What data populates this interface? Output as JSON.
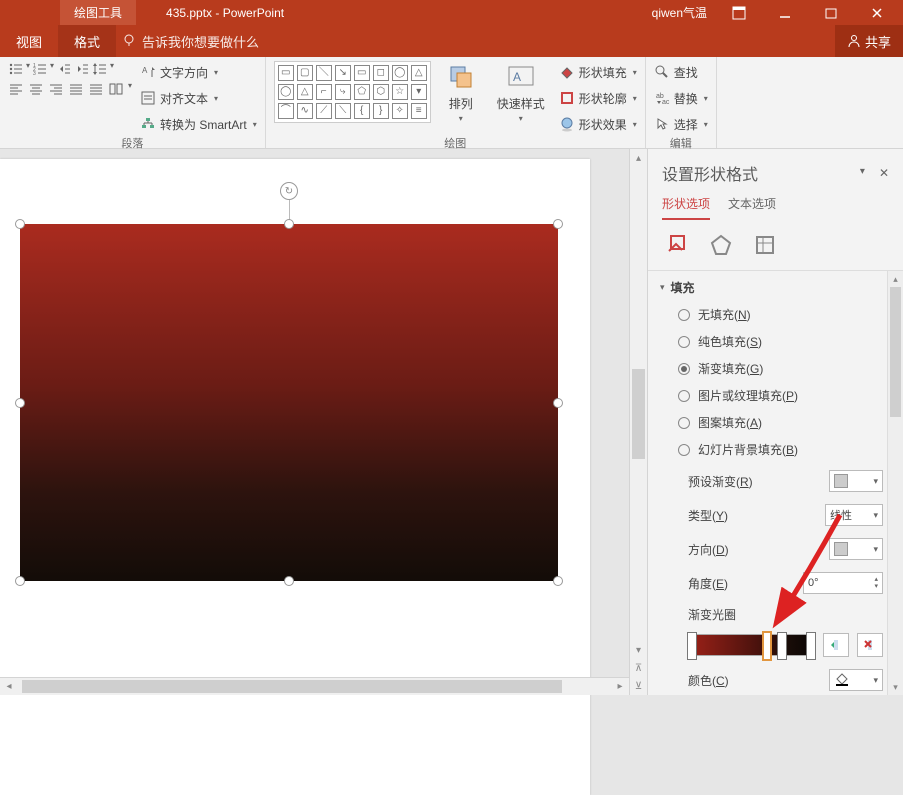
{
  "titlebar": {
    "context_tool": "绘图工具",
    "doc_title": "435.pptx - PowerPoint",
    "user": "qiwen气温"
  },
  "tabbar": {
    "view": "视图",
    "format": "格式",
    "tell_me": "告诉我你想要做什么",
    "share": "共享"
  },
  "ribbon": {
    "paragraph_label": "段落",
    "text_direction": "文字方向",
    "align_text": "对齐文本",
    "convert_smartart": "转换为 SmartArt",
    "drawing_label": "绘图",
    "arrange": "排列",
    "quick_styles": "快速样式",
    "shape_fill": "形状填充",
    "shape_outline": "形状轮廓",
    "shape_effects": "形状效果",
    "editing_label": "编辑",
    "find": "查找",
    "replace": "替换",
    "select": "选择"
  },
  "pane": {
    "title": "设置形状格式",
    "tab_shape": "形状选项",
    "tab_text": "文本选项",
    "section_fill": "填充",
    "fill_options": {
      "none": "无填充(N)",
      "solid": "纯色填充(S)",
      "gradient": "渐变填充(G)",
      "picture": "图片或纹理填充(P)",
      "pattern": "图案填充(A)",
      "slidebg": "幻灯片背景填充(B)"
    },
    "preset_grad": "预设渐变(R)",
    "type": "类型(Y)",
    "type_value": "线性",
    "direction": "方向(D)",
    "angle": "角度(E)",
    "angle_value": "0°",
    "grad_stops": "渐变光圈",
    "color": "颜色(C)"
  }
}
